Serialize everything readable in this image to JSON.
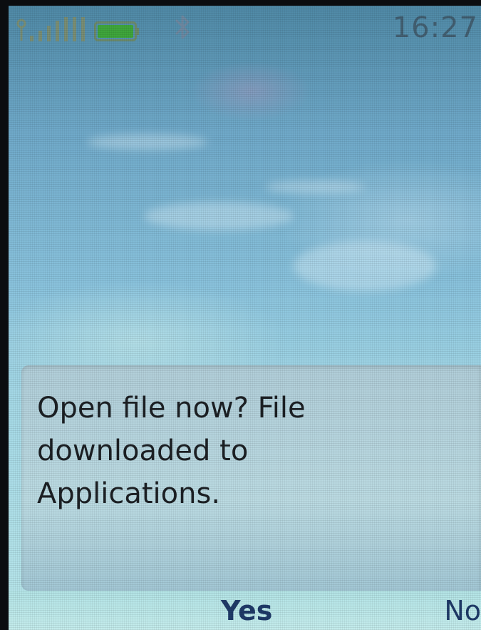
{
  "status_bar": {
    "time": "16:27",
    "icons": [
      "signal-strength-icon",
      "battery-icon",
      "bluetooth-icon"
    ]
  },
  "dialog": {
    "message": "Open file now? File\ndownloaded to\nApplications."
  },
  "softkeys": {
    "left": "",
    "middle": "Yes",
    "right": "No"
  },
  "colors": {
    "softkey_text": "#1f3a68",
    "message_text": "#1c2024",
    "battery_fill": "#3fa63c"
  }
}
